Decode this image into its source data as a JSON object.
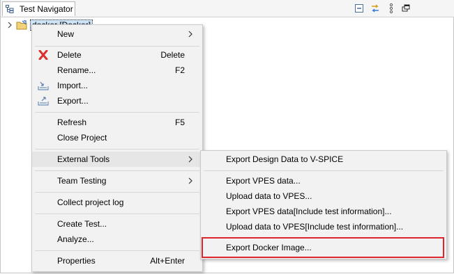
{
  "view": {
    "tab_label": "Test Navigator",
    "toolbar": [
      "collapse-all-icon",
      "link-with-editor-icon",
      "view-menu-icon",
      "maximize-icon"
    ]
  },
  "tree": {
    "project_label": "docker [Docker]"
  },
  "context_menu": {
    "new": "New",
    "delete": "Delete",
    "delete_shortcut": "Delete",
    "rename": "Rename...",
    "rename_shortcut": "F2",
    "import": "Import...",
    "export": "Export...",
    "refresh": "Refresh",
    "refresh_shortcut": "F5",
    "close_project": "Close Project",
    "external_tools": "External Tools",
    "team_testing": "Team Testing",
    "collect_log": "Collect project log",
    "create_test": "Create Test...",
    "analyze": "Analyze...",
    "properties": "Properties",
    "properties_shortcut": "Alt+Enter"
  },
  "submenu": {
    "export_design": "Export Design Data to V-SPICE",
    "export_vpes": "Export VPES data...",
    "upload_vpes": "Upload data to VPES...",
    "export_vpes_info": "Export VPES data[Include test information]...",
    "upload_vpes_info": "Upload data to VPES[Include test information]...",
    "export_docker": "Export Docker Image..."
  },
  "colors": {
    "highlight_border": "#e0242b",
    "menu_background": "#f2f2f2",
    "delete_icon": "#d9312b"
  }
}
